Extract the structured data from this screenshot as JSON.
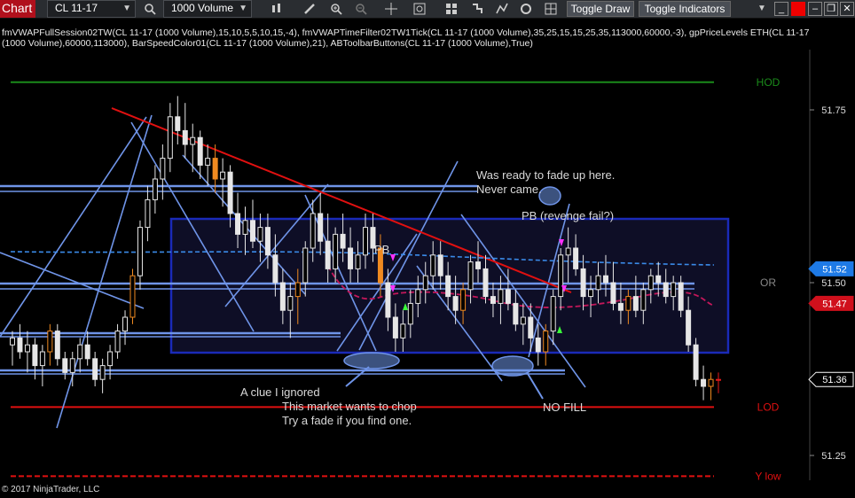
{
  "toolbar": {
    "tab_label": "Chart",
    "instrument": "CL 11-17",
    "bar_type": "1000 Volume",
    "toggle_draw": "Toggle Draw",
    "toggle_indicators": "Toggle Indicators",
    "icons": [
      "search-icon",
      "bar-style-icon",
      "pencil-icon",
      "zoom-in-icon",
      "zoom-out-icon",
      "crosshair-icon",
      "properties-icon",
      "strategy-icon",
      "alerts-icon",
      "drawing-tools-icon",
      "refresh-icon",
      "grid-icon"
    ]
  },
  "indicators_text": "fmVWAPFullSession02TW(CL 11-17 (1000 Volume),15,10,5,5,10,15,-4), fmVWAPTimeFilter02TW1Tick(CL 11-17 (1000 Volume),35,25,15,15,25,35,113000,60000,-3), gpPriceLevels ETH(CL 11-17 (1000 Volume),60000,113000), BarSpeedColor01(CL 11-17 (1000 Volume),21), ABToolbarButtons(CL 11-17 (1000 Volume),True)",
  "side_label": "F",
  "chart_data": {
    "type": "candlestick",
    "ylim": [
      51.2,
      51.83
    ],
    "y_ticks": [
      {
        "value": 51.75,
        "label": "51.75"
      },
      {
        "value": 51.5,
        "label": "51.50"
      },
      {
        "value": 51.25,
        "label": "51.25"
      }
    ],
    "price_markers": [
      {
        "value": 51.52,
        "label": "51.52",
        "color": "#1e7ae6"
      },
      {
        "value": 51.47,
        "label": "51.47",
        "color": "#d0101c"
      },
      {
        "value": 51.36,
        "label": "51.36",
        "color": "#000000"
      }
    ],
    "levels": [
      {
        "label": "HOD",
        "value": 51.79,
        "color": "#1a8a1a"
      },
      {
        "label": "OR",
        "value": 51.5,
        "color": "#888888"
      },
      {
        "label": "LOD",
        "value": 51.32,
        "color": "#e01010"
      },
      {
        "label": "Y low",
        "value": 51.22,
        "color": "#e01010"
      }
    ],
    "annotations": [
      "Was ready to fade up here.",
      "Never came.",
      "PB (revenge fail?)",
      "PB",
      "A clue I ignored",
      "This market wants to chop",
      "Try a fade if you find one.",
      "NO FILL"
    ],
    "candles": [
      {
        "o": 51.41,
        "h": 51.43,
        "l": 51.38,
        "c": 51.42
      },
      {
        "o": 51.42,
        "h": 51.44,
        "l": 51.39,
        "c": 51.4
      },
      {
        "o": 51.4,
        "h": 51.43,
        "l": 51.37,
        "c": 51.41
      },
      {
        "o": 51.41,
        "h": 51.42,
        "l": 51.36,
        "c": 51.38
      },
      {
        "o": 51.38,
        "h": 51.41,
        "l": 51.35,
        "c": 51.4
      },
      {
        "o": 51.4,
        "h": 51.44,
        "l": 51.38,
        "c": 51.43
      },
      {
        "o": 51.43,
        "h": 51.44,
        "l": 51.38,
        "c": 51.39
      },
      {
        "o": 51.39,
        "h": 51.4,
        "l": 51.36,
        "c": 51.37
      },
      {
        "o": 51.37,
        "h": 51.4,
        "l": 51.35,
        "c": 51.39
      },
      {
        "o": 51.39,
        "h": 51.42,
        "l": 51.37,
        "c": 51.41
      },
      {
        "o": 51.41,
        "h": 51.43,
        "l": 51.38,
        "c": 51.39
      },
      {
        "o": 51.39,
        "h": 51.4,
        "l": 51.35,
        "c": 51.36
      },
      {
        "o": 51.36,
        "h": 51.39,
        "l": 51.34,
        "c": 51.38
      },
      {
        "o": 51.38,
        "h": 51.41,
        "l": 51.36,
        "c": 51.4
      },
      {
        "o": 51.4,
        "h": 51.44,
        "l": 51.39,
        "c": 51.43
      },
      {
        "o": 51.43,
        "h": 51.46,
        "l": 51.41,
        "c": 51.45
      },
      {
        "o": 51.45,
        "h": 51.52,
        "l": 51.44,
        "c": 51.51
      },
      {
        "o": 51.51,
        "h": 51.59,
        "l": 51.49,
        "c": 51.58
      },
      {
        "o": 51.58,
        "h": 51.64,
        "l": 51.56,
        "c": 51.62
      },
      {
        "o": 51.62,
        "h": 51.67,
        "l": 51.6,
        "c": 51.65
      },
      {
        "o": 51.65,
        "h": 51.7,
        "l": 51.62,
        "c": 51.68
      },
      {
        "o": 51.68,
        "h": 51.76,
        "l": 51.66,
        "c": 51.74
      },
      {
        "o": 51.74,
        "h": 51.77,
        "l": 51.7,
        "c": 51.72
      },
      {
        "o": 51.72,
        "h": 51.76,
        "l": 51.68,
        "c": 51.7
      },
      {
        "o": 51.7,
        "h": 51.73,
        "l": 51.66,
        "c": 51.71
      },
      {
        "o": 51.71,
        "h": 51.72,
        "l": 51.65,
        "c": 51.67
      },
      {
        "o": 51.67,
        "h": 51.7,
        "l": 51.64,
        "c": 51.68
      },
      {
        "o": 51.68,
        "h": 51.7,
        "l": 51.63,
        "c": 51.65
      },
      {
        "o": 51.65,
        "h": 51.68,
        "l": 51.61,
        "c": 51.66
      },
      {
        "o": 51.66,
        "h": 51.67,
        "l": 51.58,
        "c": 51.6
      },
      {
        "o": 51.6,
        "h": 51.63,
        "l": 51.55,
        "c": 51.57
      },
      {
        "o": 51.57,
        "h": 51.61,
        "l": 51.54,
        "c": 51.59
      },
      {
        "o": 51.59,
        "h": 51.62,
        "l": 51.55,
        "c": 51.56
      },
      {
        "o": 51.56,
        "h": 51.6,
        "l": 51.53,
        "c": 51.58
      },
      {
        "o": 51.58,
        "h": 51.6,
        "l": 51.52,
        "c": 51.54
      },
      {
        "o": 51.54,
        "h": 51.57,
        "l": 51.48,
        "c": 51.5
      },
      {
        "o": 51.5,
        "h": 51.52,
        "l": 51.44,
        "c": 51.46
      },
      {
        "o": 51.46,
        "h": 51.5,
        "l": 51.42,
        "c": 51.48
      },
      {
        "o": 51.48,
        "h": 51.52,
        "l": 51.44,
        "c": 51.5
      },
      {
        "o": 51.5,
        "h": 51.56,
        "l": 51.48,
        "c": 51.55
      },
      {
        "o": 51.55,
        "h": 51.62,
        "l": 51.53,
        "c": 51.6
      },
      {
        "o": 51.6,
        "h": 51.63,
        "l": 51.54,
        "c": 51.56
      },
      {
        "o": 51.56,
        "h": 51.6,
        "l": 51.5,
        "c": 51.52
      },
      {
        "o": 51.52,
        "h": 51.58,
        "l": 51.5,
        "c": 51.57
      },
      {
        "o": 51.57,
        "h": 51.6,
        "l": 51.53,
        "c": 51.55
      },
      {
        "o": 51.55,
        "h": 51.58,
        "l": 51.5,
        "c": 51.52
      },
      {
        "o": 51.52,
        "h": 51.56,
        "l": 51.5,
        "c": 51.54
      },
      {
        "o": 51.54,
        "h": 51.6,
        "l": 51.52,
        "c": 51.58
      },
      {
        "o": 51.58,
        "h": 51.6,
        "l": 51.53,
        "c": 51.55
      },
      {
        "o": 51.55,
        "h": 51.57,
        "l": 51.48,
        "c": 51.5
      },
      {
        "o": 51.5,
        "h": 51.52,
        "l": 51.43,
        "c": 51.45
      },
      {
        "o": 51.45,
        "h": 51.47,
        "l": 51.4,
        "c": 51.42
      },
      {
        "o": 51.42,
        "h": 51.46,
        "l": 51.4,
        "c": 51.44
      },
      {
        "o": 51.44,
        "h": 51.49,
        "l": 51.42,
        "c": 51.47
      },
      {
        "o": 51.47,
        "h": 51.51,
        "l": 51.45,
        "c": 51.49
      },
      {
        "o": 51.49,
        "h": 51.53,
        "l": 51.47,
        "c": 51.51
      },
      {
        "o": 51.51,
        "h": 51.56,
        "l": 51.49,
        "c": 51.54
      },
      {
        "o": 51.54,
        "h": 51.56,
        "l": 51.49,
        "c": 51.51
      },
      {
        "o": 51.51,
        "h": 51.53,
        "l": 51.46,
        "c": 51.48
      },
      {
        "o": 51.48,
        "h": 51.51,
        "l": 51.44,
        "c": 51.46
      },
      {
        "o": 51.46,
        "h": 51.5,
        "l": 51.44,
        "c": 51.49
      },
      {
        "o": 51.49,
        "h": 51.54,
        "l": 51.47,
        "c": 51.53
      },
      {
        "o": 51.53,
        "h": 51.56,
        "l": 51.5,
        "c": 51.52
      },
      {
        "o": 51.52,
        "h": 51.54,
        "l": 51.47,
        "c": 51.48
      },
      {
        "o": 51.48,
        "h": 51.5,
        "l": 51.45,
        "c": 51.47
      },
      {
        "o": 51.47,
        "h": 51.51,
        "l": 51.44,
        "c": 51.49
      },
      {
        "o": 51.49,
        "h": 51.52,
        "l": 51.46,
        "c": 51.47
      },
      {
        "o": 51.47,
        "h": 51.49,
        "l": 51.43,
        "c": 51.44
      },
      {
        "o": 51.44,
        "h": 51.47,
        "l": 51.41,
        "c": 51.45
      },
      {
        "o": 51.45,
        "h": 51.47,
        "l": 51.4,
        "c": 51.42
      },
      {
        "o": 51.42,
        "h": 51.44,
        "l": 51.38,
        "c": 51.4
      },
      {
        "o": 51.4,
        "h": 51.44,
        "l": 51.38,
        "c": 51.43
      },
      {
        "o": 51.43,
        "h": 51.49,
        "l": 51.41,
        "c": 51.48
      },
      {
        "o": 51.48,
        "h": 51.55,
        "l": 51.46,
        "c": 51.54
      },
      {
        "o": 51.54,
        "h": 51.58,
        "l": 51.5,
        "c": 51.55
      },
      {
        "o": 51.55,
        "h": 51.57,
        "l": 51.51,
        "c": 51.52
      },
      {
        "o": 51.52,
        "h": 51.54,
        "l": 51.46,
        "c": 51.48
      },
      {
        "o": 51.48,
        "h": 51.51,
        "l": 51.45,
        "c": 51.49
      },
      {
        "o": 51.49,
        "h": 51.53,
        "l": 51.47,
        "c": 51.51
      },
      {
        "o": 51.51,
        "h": 51.54,
        "l": 51.48,
        "c": 51.5
      },
      {
        "o": 51.5,
        "h": 51.53,
        "l": 51.46,
        "c": 51.47
      },
      {
        "o": 51.47,
        "h": 51.5,
        "l": 51.44,
        "c": 51.46
      },
      {
        "o": 51.46,
        "h": 51.49,
        "l": 51.44,
        "c": 51.48
      },
      {
        "o": 51.48,
        "h": 51.51,
        "l": 51.45,
        "c": 51.46
      },
      {
        "o": 51.46,
        "h": 51.5,
        "l": 51.44,
        "c": 51.49
      },
      {
        "o": 51.49,
        "h": 51.52,
        "l": 51.47,
        "c": 51.51
      },
      {
        "o": 51.51,
        "h": 51.53,
        "l": 51.48,
        "c": 51.5
      },
      {
        "o": 51.5,
        "h": 51.52,
        "l": 51.47,
        "c": 51.48
      },
      {
        "o": 51.48,
        "h": 51.51,
        "l": 51.46,
        "c": 51.5
      },
      {
        "o": 51.5,
        "h": 51.51,
        "l": 51.45,
        "c": 51.46
      },
      {
        "o": 51.46,
        "h": 51.48,
        "l": 51.4,
        "c": 51.41
      },
      {
        "o": 51.41,
        "h": 51.42,
        "l": 51.35,
        "c": 51.36
      },
      {
        "o": 51.36,
        "h": 51.38,
        "l": 51.33,
        "c": 51.35
      },
      {
        "o": 51.35,
        "h": 51.37,
        "l": 51.33,
        "c": 51.36
      },
      {
        "o": 51.36,
        "h": 51.37,
        "l": 51.34,
        "c": 51.36
      }
    ]
  },
  "copyright": "© 2017 NinjaTrader, LLC"
}
